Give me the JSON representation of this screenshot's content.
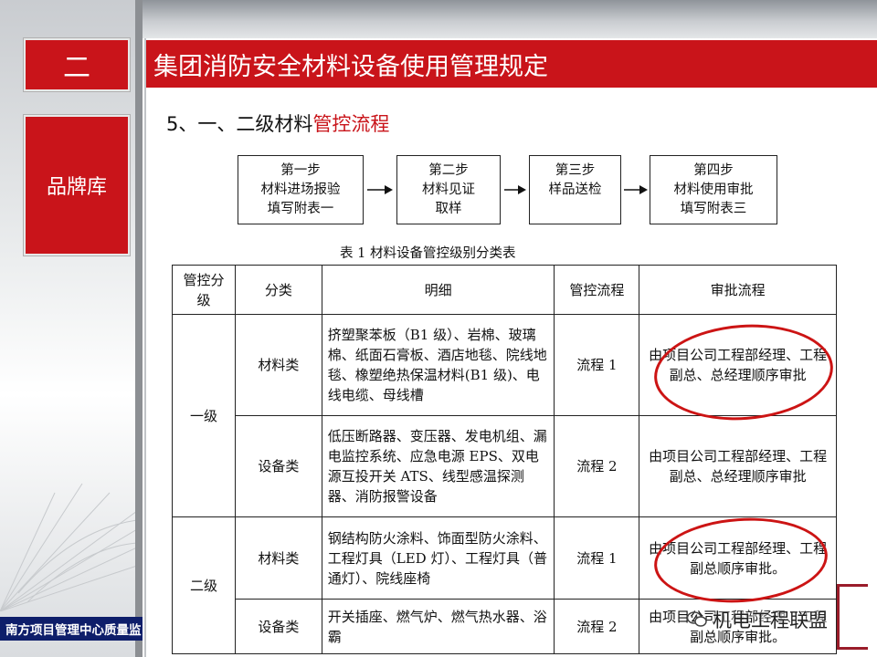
{
  "section": {
    "number": "二",
    "title": "集团消防安全材料设备使用管理规定"
  },
  "sidebar": {
    "label": "品牌库"
  },
  "subtitle": {
    "prefix": "5、一、二级材料",
    "highlight": "管控流程"
  },
  "steps": [
    {
      "line1": "第一步",
      "line2": "材料进场报验",
      "line3": "填写附表一"
    },
    {
      "line1": "第二步",
      "line2": "材料见证",
      "line3": "取样"
    },
    {
      "line1": "第三步",
      "line2": "样品送检",
      "line3": ""
    },
    {
      "line1": "第四步",
      "line2": "材料使用审批",
      "line3": "填写附表三"
    }
  ],
  "table": {
    "caption": "表 1  材料设备管控级别分类表",
    "headers": {
      "level": "管控分级",
      "category": "分类",
      "detail": "明细",
      "process": "管控流程",
      "approval": "审批流程"
    },
    "levels": {
      "one": "一级",
      "two": "二级"
    },
    "rows": [
      {
        "category": "材料类",
        "detail": "挤塑聚苯板（B1 级）、岩棉、玻璃棉、纸面石膏板、酒店地毯、院线地毯、橡塑绝热保温材料(B1 级)、电线电缆、母线槽",
        "process": "流程 1",
        "approval": "由项目公司工程部经理、工程副总、总经理顺序审批"
      },
      {
        "category": "设备类",
        "detail": "低压断路器、变压器、发电机组、漏电监控系统、应急电源 EPS、双电源互投开关 ATS、线型感温探测器、消防报警设备",
        "process": "流程 2",
        "approval": "由项目公司工程部经理、工程副总、总经理顺序审批"
      },
      {
        "category": "材料类",
        "detail": "钢结构防火涂料、饰面型防火涂料、工程灯具（LED 灯）、工程灯具（普通灯）、院线座椅",
        "process": "流程 1",
        "approval": "由项目公司工程部经理、工程副总顺序审批。"
      },
      {
        "category": "设备类",
        "detail": "开关插座、燃气炉、燃气热水器、浴霸",
        "process": "流程 2",
        "approval": "由项目公司工程部经理、工程副总顺序审批。"
      }
    ]
  },
  "footer": {
    "text": "南方项目管理中心质量监"
  },
  "watermark": {
    "text": "机电工程联盟",
    "icon": "wechat-icon"
  },
  "colors": {
    "accent": "#c9141a",
    "footer": "#0e1e6a"
  }
}
